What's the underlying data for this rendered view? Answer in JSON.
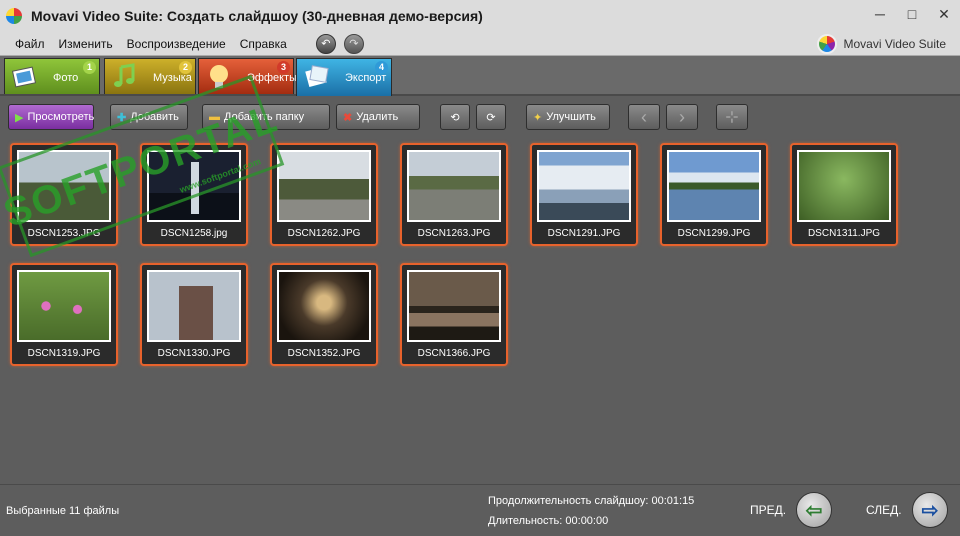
{
  "window": {
    "title": "Movavi Video Suite: Создать слайдшоу (30-дневная демо-версия)",
    "minimize_glyph": "─",
    "maximize_glyph": "□",
    "close_glyph": "✕"
  },
  "menu": {
    "items": [
      "Файл",
      "Изменить",
      "Воспроизведение",
      "Справка"
    ],
    "undo_glyph": "↶",
    "redo_glyph": "↷",
    "brand": "Movavi Video Suite"
  },
  "tabs": [
    {
      "label": "Фото",
      "number": "1",
      "badge_color": "#a4d44a"
    },
    {
      "label": "Музыка",
      "number": "2",
      "badge_color": "#e2c43a"
    },
    {
      "label": "Эффекты",
      "number": "3",
      "badge_color": "#d23a2a"
    },
    {
      "label": "Экспорт",
      "number": "4",
      "badge_color": "#2f9ad8"
    }
  ],
  "toolbar": {
    "preview": "Просмотреть",
    "add": "Добавить",
    "add_folder": "Добавить папку",
    "delete": "Удалить",
    "enhance": "Улучшить",
    "rotate_left_glyph": "⟲",
    "rotate_right_glyph": "⟳",
    "prev_glyph": "‹",
    "next_glyph": "›",
    "fit_glyph": "⊹"
  },
  "watermark": {
    "text": "SOFTPORTAL",
    "url": "www.softportal.com"
  },
  "photos": [
    {
      "name": "DSCN1253.JPG",
      "sky": "#b8c4cc",
      "ground": "#4a5a38"
    },
    {
      "name": "DSCN1258.jpg",
      "sky": "#1a2030",
      "ground": "#0c1018"
    },
    {
      "name": "DSCN1262.JPG",
      "sky": "#d8dde2",
      "ground": "#5a6448"
    },
    {
      "name": "DSCN1263.JPG",
      "sky": "#c4cdd6",
      "ground": "#6c6e66"
    },
    {
      "name": "DSCN1291.JPG",
      "sky": "#7fa4d0",
      "ground": "#3a4a58"
    },
    {
      "name": "DSCN1299.JPG",
      "sky": "#6f9ad0",
      "ground": "#3e5a78"
    },
    {
      "name": "DSCN1311.JPG",
      "sky": "#5f8a3a",
      "ground": "#3d5e24"
    },
    {
      "name": "DSCN1319.JPG",
      "sky": "#6f9a42",
      "ground": "#4a6c2a"
    },
    {
      "name": "DSCN1330.JPG",
      "sky": "#b8c2cc",
      "ground": "#5e4e44"
    },
    {
      "name": "DSCN1352.JPG",
      "sky": "#4a3a2a",
      "ground": "#1a140e"
    },
    {
      "name": "DSCN1366.JPG",
      "sky": "#6a5a4a",
      "ground": "#1e1a14"
    }
  ],
  "status": {
    "selected": "Выбранные 11 файлы",
    "slideshow_duration": "Продолжительность слайдшоу: 00:01:15",
    "duration": "Длительность: 00:00:00",
    "prev": "ПРЕД.",
    "next": "СЛЕД.",
    "prev_glyph": "⇦",
    "next_glyph": "⇨"
  }
}
